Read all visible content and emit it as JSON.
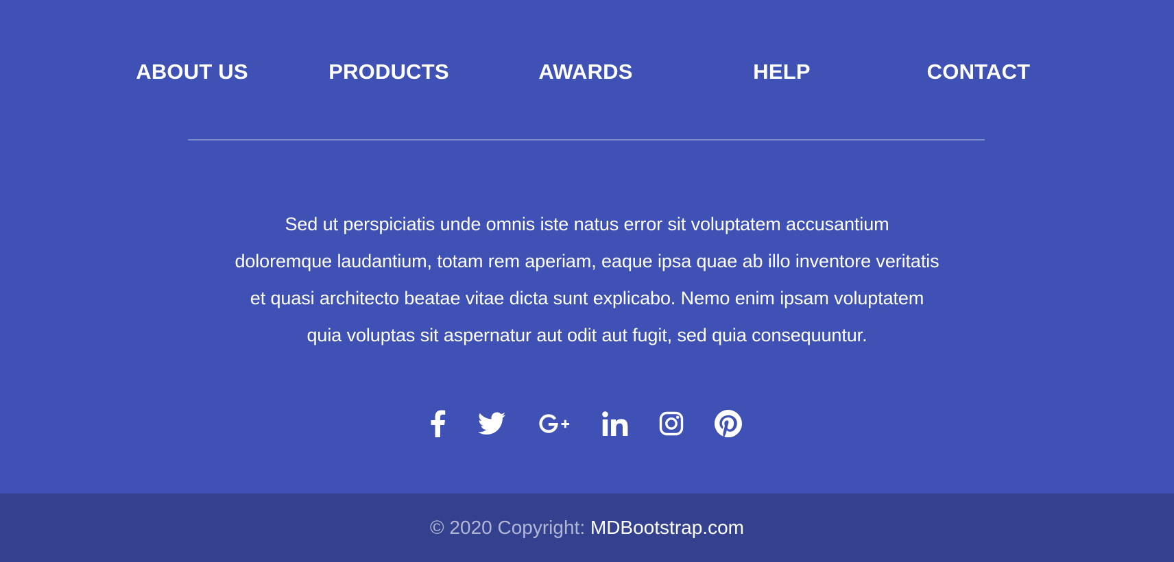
{
  "nav": {
    "items": [
      {
        "label": "ABOUT US"
      },
      {
        "label": "PRODUCTS"
      },
      {
        "label": "AWARDS"
      },
      {
        "label": "HELP"
      },
      {
        "label": "CONTACT"
      }
    ]
  },
  "description": {
    "lines": [
      "Sed ut perspiciatis unde omnis iste natus error sit voluptatem accusantium",
      "doloremque laudantium, totam rem aperiam, eaque ipsa quae ab illo inventore veritatis",
      "et quasi architecto beatae vitae dicta sunt explicabo. Nemo enim ipsam voluptatem",
      "quia voluptas sit aspernatur aut odit aut fugit, sed quia consequuntur."
    ]
  },
  "social": {
    "icons": [
      "facebook-icon",
      "twitter-icon",
      "google-plus-icon",
      "linkedin-icon",
      "instagram-icon",
      "pinterest-icon"
    ]
  },
  "copyright": {
    "prefix": "© 2020 Copyright:",
    "link_text": "MDBootstrap.com"
  },
  "colors": {
    "background": "#3f51b5",
    "copyright_bar": "#34418f",
    "text": "#ffffff"
  }
}
